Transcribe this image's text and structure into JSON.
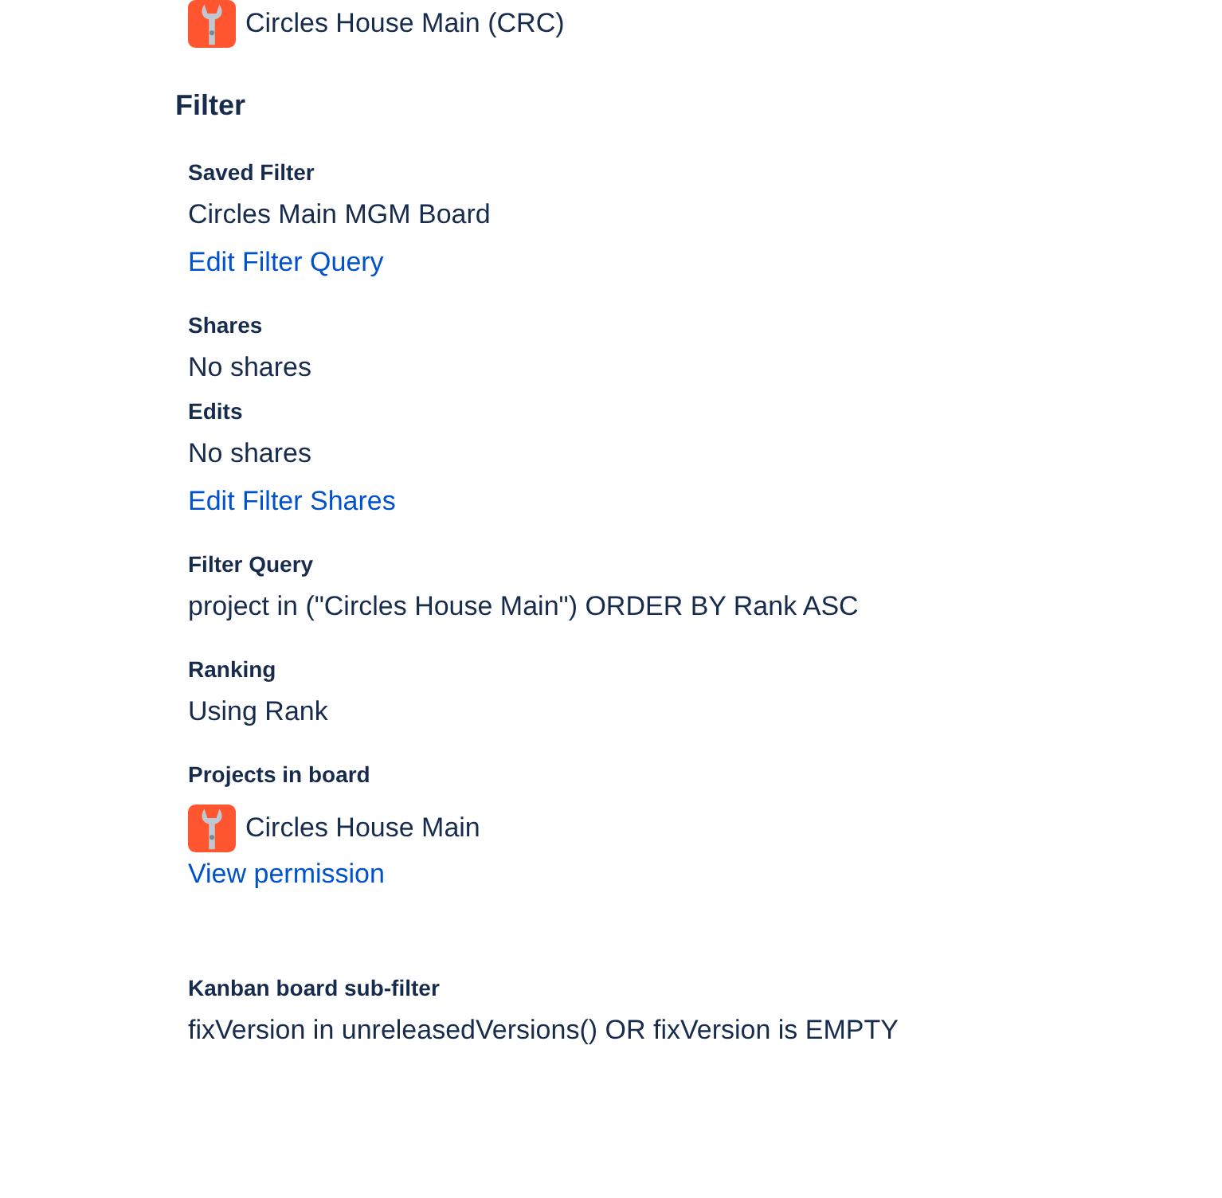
{
  "top_project": {
    "name": "Circles House Main (CRC)"
  },
  "heading": "Filter",
  "sections": [
    {
      "label": "Saved Filter",
      "items": [
        {
          "kind": "text",
          "text": "Circles Main MGM Board"
        },
        {
          "kind": "link",
          "text": "Edit Filter Query"
        }
      ]
    },
    {
      "label": "Shares",
      "items": [
        {
          "kind": "text",
          "text": "No shares"
        }
      ]
    },
    {
      "label": "Edits",
      "items": [
        {
          "kind": "text",
          "text": "No shares"
        },
        {
          "kind": "link",
          "text": "Edit Filter Shares"
        }
      ]
    },
    {
      "label": "Filter Query",
      "items": [
        {
          "kind": "text",
          "text": "project in (\"Circles House Main\") ORDER BY Rank ASC"
        }
      ]
    },
    {
      "label": "Ranking",
      "items": [
        {
          "kind": "text",
          "text": "Using Rank"
        }
      ]
    },
    {
      "label": "Projects in board",
      "items": [
        {
          "kind": "project",
          "text": "Circles House Main"
        },
        {
          "kind": "link",
          "text": "View permission"
        }
      ]
    },
    {
      "label": "Kanban board sub-filter",
      "items": [
        {
          "kind": "text",
          "text": "fixVersion in unreleasedVersions() OR fixVersion is EMPTY"
        }
      ]
    }
  ]
}
